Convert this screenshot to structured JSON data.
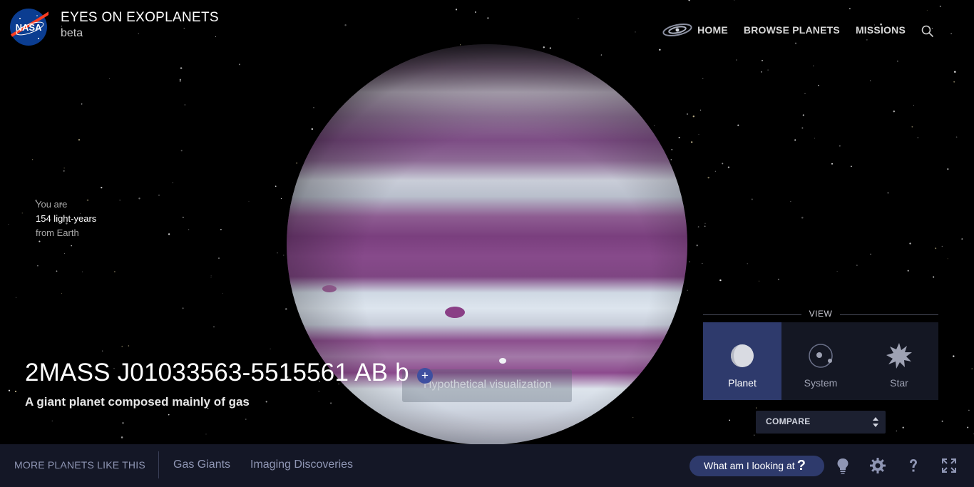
{
  "header": {
    "title": "EYES ON EXOPLANETS",
    "subtitle": "beta",
    "logo_text": "NASA",
    "nav": [
      {
        "label": "HOME"
      },
      {
        "label": "BROWSE PLANETS"
      },
      {
        "label": "MISSIONS"
      }
    ]
  },
  "distance": {
    "line1": "You are",
    "line2": "154 light-years",
    "line3": "from Earth"
  },
  "planet": {
    "name": "2MASS J01033563-5515561 AB b",
    "description": "A giant planet composed mainly of gas",
    "hypo_button": "+",
    "hypo_label": "Hypothetical visualization"
  },
  "view": {
    "heading": "VIEW",
    "options": [
      {
        "label": "Planet",
        "icon": "planet-icon"
      },
      {
        "label": "System",
        "icon": "system-icon"
      },
      {
        "label": "Star",
        "icon": "star-icon"
      }
    ],
    "active": "Planet"
  },
  "compare": {
    "label": "COMPARE"
  },
  "bottom_bar": {
    "more_label": "MORE PLANETS LIKE THIS",
    "categories": [
      "Gas Giants",
      "Imaging Discoveries"
    ],
    "what_button": "What am I looking at",
    "what_q": "?",
    "tools": [
      "lightbulb-icon",
      "gear-icon",
      "help-icon",
      "fullscreen-icon"
    ]
  },
  "colors": {
    "panel_bg": "#141726",
    "active_blue": "#2e3a6c",
    "muted_text": "#8f96b4"
  }
}
